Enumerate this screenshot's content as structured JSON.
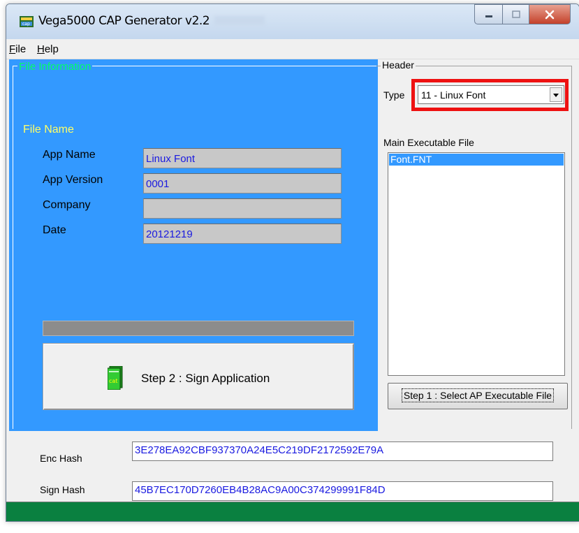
{
  "window": {
    "title": "Vega5000 CAP Generator v2.2"
  },
  "menu": {
    "file": {
      "first": "F",
      "rest": "ile"
    },
    "help": {
      "first": "H",
      "rest": "elp"
    }
  },
  "file_info": {
    "legend": "File Information",
    "file_name_label": "File Name",
    "fields": [
      {
        "label": "App Name",
        "value": "Linux Font"
      },
      {
        "label": "App Version",
        "value": "0001"
      },
      {
        "label": "Company",
        "value": ""
      },
      {
        "label": "Date",
        "value": "20121219"
      }
    ],
    "sign_button_label": "Step 2 : Sign Application",
    "sign_icon_text": "cat"
  },
  "header": {
    "legend": "Header",
    "type_label": "Type",
    "type_value": "11 - Linux Font",
    "main_exe_label": "Main Executable File",
    "main_exe_items": [
      "Font.FNT"
    ],
    "select_button_label": "Step 1 : Select AP Executable File"
  },
  "hashes": {
    "enc_label": "Enc Hash",
    "enc_value": "3E278EA92CBF937370A24E5C219DF2172592E79A",
    "sign_label": "Sign Hash",
    "sign_value": "45B7EC170D7260EB4B28AC9A00C374299991F84D"
  },
  "colors": {
    "panel_blue": "#3399ff",
    "legend_green": "#00ff66",
    "file_name_yellow": "#ffff66",
    "highlight_red": "#ee1111",
    "status_green": "#0a8040"
  }
}
